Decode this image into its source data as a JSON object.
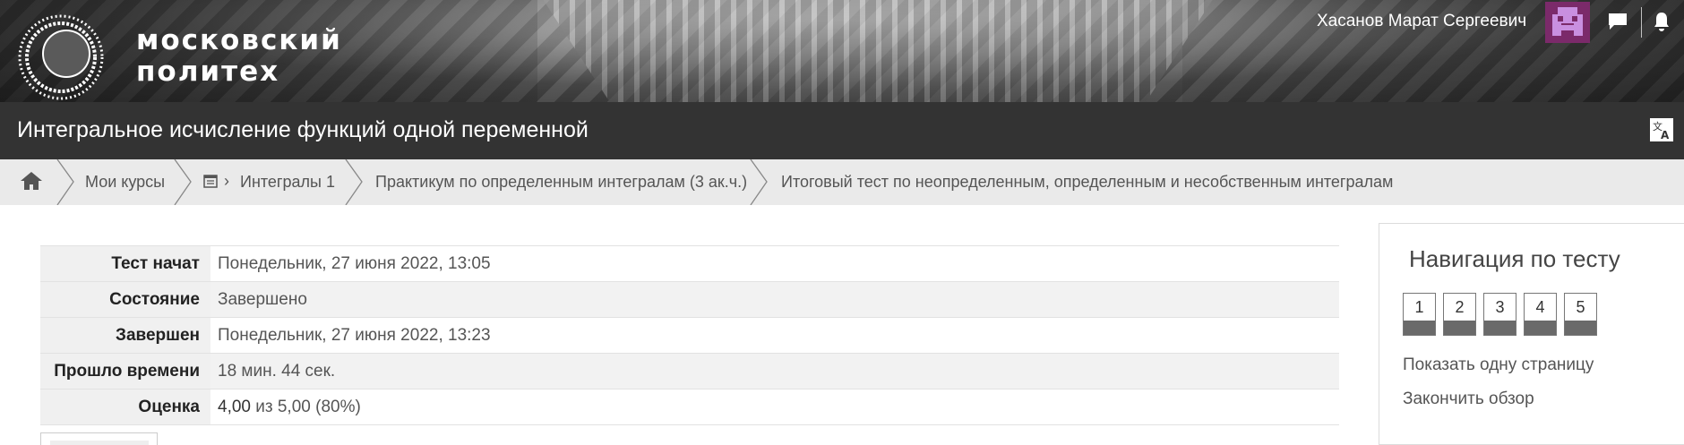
{
  "header": {
    "logo_text": [
      "московский",
      "политех"
    ],
    "user_name": "Хасанов Марат Сергеевич",
    "icons": [
      "university-logo",
      "avatar",
      "message-icon",
      "bell-icon"
    ]
  },
  "course": {
    "title": "Интегральное исчисление функций одной переменной",
    "translate_icon": "translate-icon"
  },
  "breadcrumbs": {
    "home_icon": "home-icon",
    "items": [
      "Мои курсы",
      "Интегралы 1",
      "Практикум по определенным интегралам (3 ак.ч.)",
      "Итоговый тест по неопределенным, определенным и несобственным интегралам"
    ]
  },
  "summary": {
    "rows": [
      {
        "label": "Тест начат",
        "value": "Понедельник, 27 июня 2022, 13:05"
      },
      {
        "label": "Состояние",
        "value": "Завершено"
      },
      {
        "label": "Завершен",
        "value": "Понедельник, 27 июня 2022, 13:23"
      },
      {
        "label": "Прошло времени",
        "value": "18 мин. 44 сек."
      },
      {
        "label": "Оценка",
        "value_score": "4,00",
        "value_rest": " из 5,00 (80%)"
      }
    ]
  },
  "quiz_nav": {
    "title": "Навигация по тесту",
    "questions": [
      "1",
      "2",
      "3",
      "4",
      "5"
    ],
    "show_one_page": "Показать одну страницу",
    "finish_review": "Закончить обзор"
  },
  "colors": {
    "course_bar": "#333333",
    "breadcrumb_bg": "#eaeaea",
    "avatar": "#7b2a6a"
  }
}
